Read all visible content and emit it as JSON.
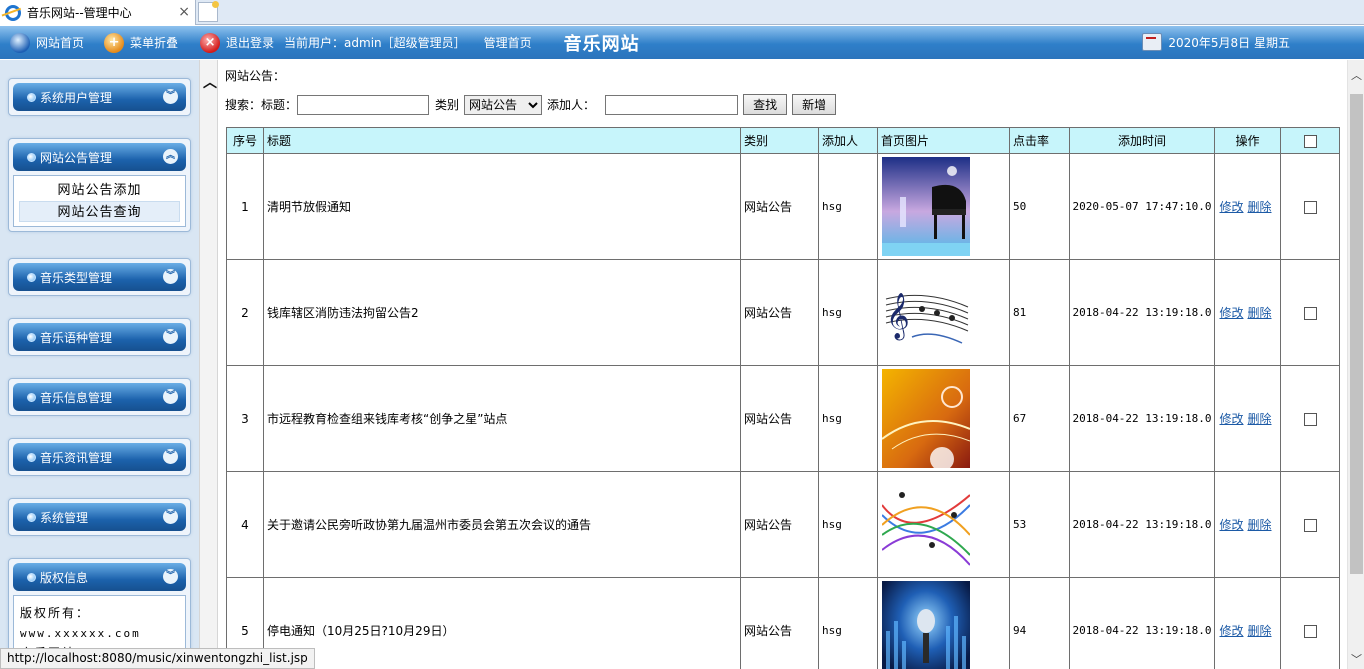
{
  "browser": {
    "tab_title": "音乐网站--管理中心",
    "status_url": "http://localhost:8080/music/xinwentongzhi_list.jsp"
  },
  "topbar": {
    "home_label": "网站首页",
    "collapse_label": "菜单折叠",
    "logout_label": "退出登录",
    "current_user": "当前用户：admin［超级管理员］",
    "admin_home": "管理首页",
    "site_name": "音乐网站",
    "date": "2020年5月8日 星期五"
  },
  "sidebar": {
    "menus": [
      {
        "label": "系统用户管理"
      },
      {
        "label": "网站公告管理",
        "expanded": true,
        "items": [
          "网站公告添加",
          "网站公告查询"
        ]
      },
      {
        "label": "音乐类型管理"
      },
      {
        "label": "音乐语种管理"
      },
      {
        "label": "音乐信息管理"
      },
      {
        "label": "音乐资讯管理"
      },
      {
        "label": "系统管理"
      },
      {
        "label": "版权信息",
        "expanded": true
      }
    ],
    "copyright": {
      "line1": "版权所有：",
      "line2": "www.xxxxxx.com",
      "line3": "库乐网站"
    }
  },
  "main": {
    "breadcrumb": "网站公告：",
    "search": {
      "prefix": "搜索：",
      "title_label": "标题：",
      "title_value": "",
      "type_label": "类别",
      "type_selected": "网站公告",
      "adder_label": "添加人：",
      "adder_value": "",
      "find_button": "查找",
      "add_button": "新增"
    },
    "table": {
      "headers": [
        "序号",
        "标题",
        "类别",
        "添加人",
        "首页图片",
        "点击率",
        "添加时间",
        "操作"
      ],
      "edit_label": "修改",
      "delete_label": "删除",
      "rows": [
        {
          "no": "1",
          "title": "清明节放假通知",
          "type": "网站公告",
          "adder": "hsg",
          "image": "piano-night-image",
          "clicks": "50",
          "time": "2020-05-07 17:47:10.0"
        },
        {
          "no": "2",
          "title": "钱库辖区消防违法拘留公告2",
          "type": "网站公告",
          "adder": "hsg",
          "image": "music-staff-image",
          "clicks": "81",
          "time": "2018-04-22 13:19:18.0"
        },
        {
          "no": "3",
          "title": "市远程教育检查组来钱库考核“创争之星”站点",
          "type": "网站公告",
          "adder": "hsg",
          "image": "orange-notes-image",
          "clicks": "67",
          "time": "2018-04-22 13:19:18.0"
        },
        {
          "no": "4",
          "title": "关于邀请公民旁听政协第九届温州市委员会第五次会议的通告",
          "type": "网站公告",
          "adder": "hsg",
          "image": "colorful-staff-image",
          "clicks": "53",
          "time": "2018-04-22 13:19:18.0"
        },
        {
          "no": "5",
          "title": "停电通知（10月25日?10月29日）",
          "type": "网站公告",
          "adder": "hsg",
          "image": "microphone-stage-image",
          "clicks": "94",
          "time": "2018-04-22 13:19:18.0"
        }
      ]
    }
  },
  "colors": {
    "topbar_blue": "#2f7fc9",
    "header_cyan": "#c7f5fb",
    "sidebar_bg": "#d9e6f3",
    "link_blue": "#1c5aa6"
  }
}
